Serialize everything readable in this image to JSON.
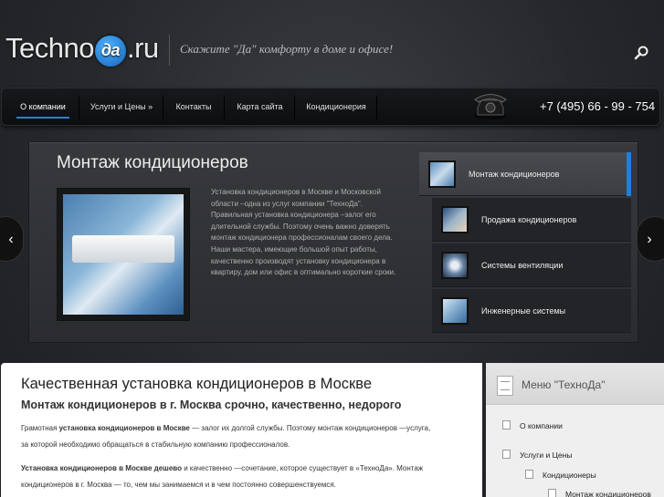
{
  "header": {
    "logo_left": "Techno",
    "logo_da": "да",
    "logo_right": ".ru",
    "slogan": "Скажите \"Да\" комфорту в доме и офисе!"
  },
  "nav": {
    "items": [
      {
        "label": "О компании",
        "active": true
      },
      {
        "label": "Услуги и Цены »"
      },
      {
        "label": "Контакты"
      },
      {
        "label": "Карта сайта"
      },
      {
        "label": "Кондиционерия"
      }
    ],
    "phone": "+7 (495) 66 - 99 - 754"
  },
  "slider": {
    "title": "Монтаж кондиционеров",
    "text": "Установка кондиционеров в Москве и Московской области  –одна из услуг компании \"ТехноДа\". Правильная установка кондиционера  –залог его длительной службы. Поэтому очень важно доверять монтаж кондиционера профессионалам своего дела. Наши мастера, имеющие большой опыт работы, качественно производят установку кондиционера в квартиру, дом или офис в оптимально короткие сроки.",
    "thumbs": [
      {
        "label": "Монтаж кондиционеров",
        "active": true
      },
      {
        "label": "Продажа кондиционеров"
      },
      {
        "label": "Системы вентиляции"
      },
      {
        "label": "Инженерные системы"
      }
    ],
    "prev": "‹",
    "next": "›"
  },
  "content": {
    "title": "Качественная установка кондиционеров в Москве",
    "subtitle": "Монтаж кондиционеров в г. Москва срочно, качественно, недорого",
    "p1_pre": "Грамотная ",
    "p1_bold": "установка кондиционеров в Москве",
    "p1_post": "  — залог их долгой  службы. Поэтому  монтаж кондиционеров —услуга,",
    "p1_line2": "за которой необходимо обращаться в стабильную компанию профессионалов.",
    "p2_bold": "Установка кондиционеров в  Москве дешево",
    "p2_post": " и качественно —сочетание, которое существует в     «ТехноДа». Монтаж",
    "p2_line2": "кондиционеров в г. Москва — то, чем мы занимаемся и в чем постоянно совершенствуемся."
  },
  "sidebar": {
    "title": "Меню \"ТехноДа\"",
    "items": [
      {
        "label": "О компании"
      },
      {
        "label": "Услуги и Цены"
      },
      {
        "label": "Кондиционеры"
      },
      {
        "label": "Монтаж кондиционеров"
      }
    ]
  },
  "colors": {
    "accent": "#1f7fe0",
    "background": "#2a2c30"
  }
}
